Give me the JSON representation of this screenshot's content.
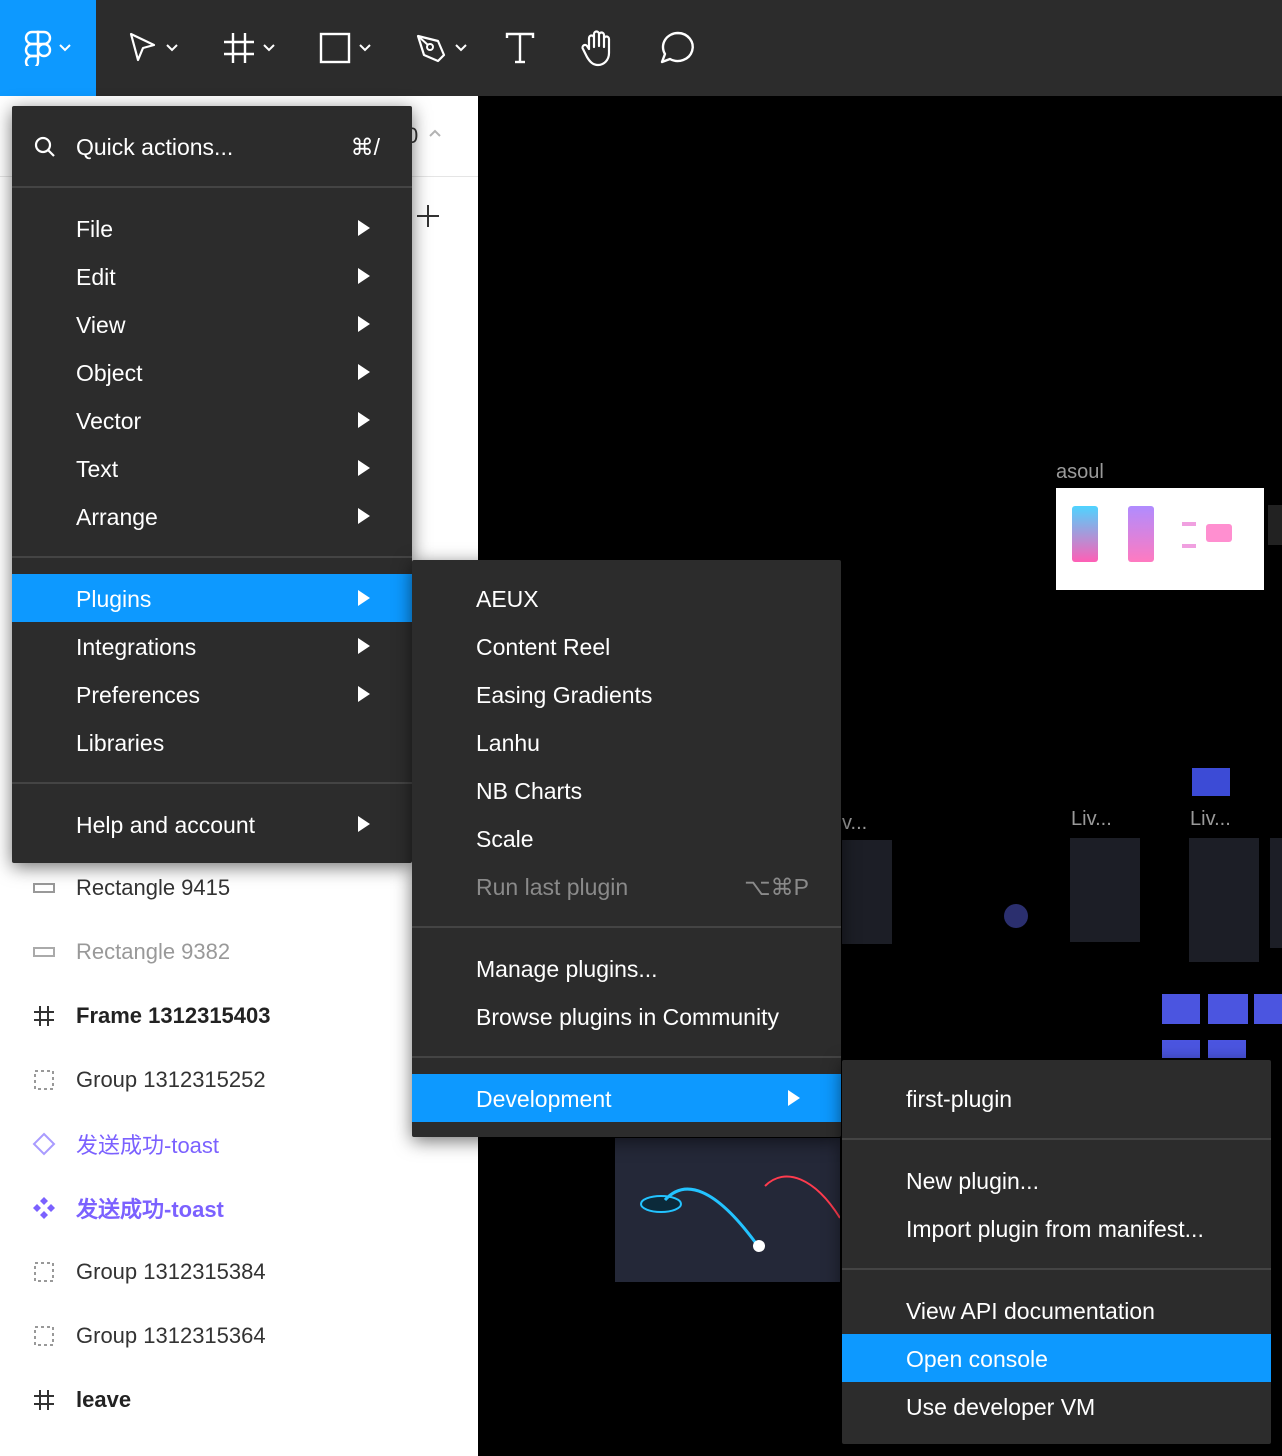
{
  "colors": {
    "accent": "#0d99ff",
    "toolbar": "#2c2c2c",
    "menu_bg": "#2c2c2c",
    "component_purple": "#7b61ff"
  },
  "toolbar": {
    "tools": [
      "figma-logo-icon",
      "move-tool-icon",
      "frame-tool-icon",
      "rectangle-tool-icon",
      "pen-tool-icon",
      "text-tool-icon",
      "hand-tool-icon",
      "comment-tool-icon"
    ]
  },
  "left_panel": {
    "frag_partial": "0",
    "layers": [
      {
        "label": "Rectangle 9415",
        "icon": "rectangle-icon"
      },
      {
        "label": "Rectangle 9382",
        "icon": "rectangle-icon"
      },
      {
        "label": "Frame 1312315403",
        "icon": "frame-icon"
      },
      {
        "label": "Group 1312315252",
        "icon": "group-icon"
      },
      {
        "label": "发送成功-toast",
        "icon": "component-instance-icon"
      },
      {
        "label": "发送成功-toast",
        "icon": "component-main-icon"
      },
      {
        "label": "Group 1312315384",
        "icon": "group-icon"
      },
      {
        "label": "Group 1312315364",
        "icon": "group-icon"
      },
      {
        "label": "leave",
        "icon": "frame-icon"
      }
    ]
  },
  "canvas": {
    "labels": {
      "asoul": "asoul",
      "liv1": "Liv...",
      "liv2": "Liv...",
      "v_partial": "v..."
    }
  },
  "main_menu": {
    "quick_actions": {
      "label": "Quick actions...",
      "shortcut": "⌘/"
    },
    "items": {
      "file": "File",
      "edit": "Edit",
      "view": "View",
      "object": "Object",
      "vector": "Vector",
      "text": "Text",
      "arrange": "Arrange",
      "plugins": "Plugins",
      "integrations": "Integrations",
      "preferences": "Preferences",
      "libraries": "Libraries",
      "help": "Help and account"
    }
  },
  "plugins_menu": {
    "items": {
      "aeux": "AEUX",
      "content_reel": "Content Reel",
      "easing": "Easing Gradients",
      "lanhu": "Lanhu",
      "nb_charts": "NB Charts",
      "scale": "Scale",
      "run_last": "Run last plugin",
      "run_last_shortcut": "⌥⌘P",
      "manage": "Manage plugins...",
      "browse": "Browse plugins in Community",
      "development": "Development"
    }
  },
  "development_menu": {
    "items": {
      "first_plugin": "first-plugin",
      "new_plugin": "New plugin...",
      "import": "Import plugin from manifest...",
      "api_docs": "View API documentation",
      "open_console": "Open console",
      "dev_vm": "Use developer VM"
    }
  }
}
